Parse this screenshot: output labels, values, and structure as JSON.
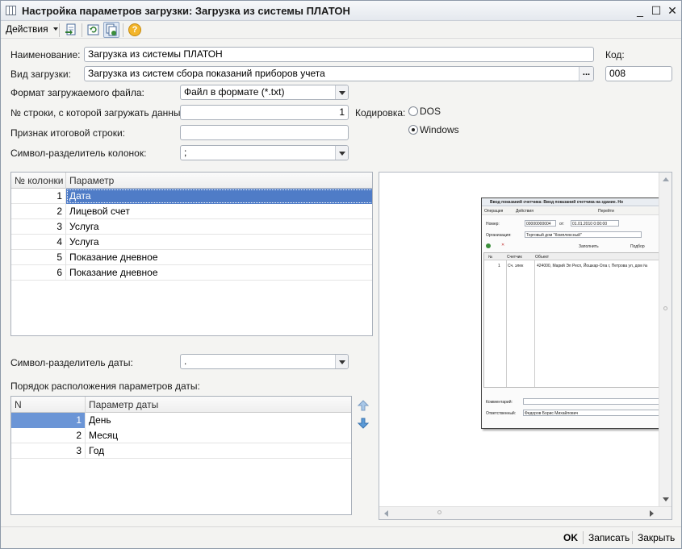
{
  "window": {
    "title": "Настройка параметров загрузки: Загрузка из системы ПЛАТОН",
    "minimize": "_",
    "maximize": "☐",
    "close": "✕"
  },
  "toolbar": {
    "actions_label": "Действия",
    "help_glyph": "?"
  },
  "form": {
    "name_label": "Наименование:",
    "name_value": "Загрузка из системы ПЛАТОН",
    "code_label": "Код:",
    "code_value": "008",
    "load_type_label": "Вид загрузки:",
    "load_type_value": "Загрузка из систем сбора показаний приборов учета",
    "load_type_button": "...",
    "file_format_label": "Формат загружаемого файла:",
    "file_format_value": "Файл в формате (*.txt)",
    "start_row_label": "№ строки, с которой загружать данные:",
    "start_row_value": "1",
    "encoding_label": "Кодировка:",
    "encoding_options": [
      "DOS",
      "Windows"
    ],
    "encoding_selected": "Windows",
    "total_row_label": "Признак итоговой строки:",
    "total_row_value": "",
    "column_sep_label": "Символ-разделитель колонок:",
    "column_sep_value": ";",
    "date_sep_label": "Символ-разделитель даты:",
    "date_sep_value": ".",
    "date_order_label": "Порядок расположения параметров даты:"
  },
  "columns_table": {
    "headers": [
      "№ колонки",
      "Параметр"
    ],
    "rows": [
      {
        "n": "1",
        "param": "Дата"
      },
      {
        "n": "2",
        "param": "Лицевой счет"
      },
      {
        "n": "3",
        "param": "Услуга"
      },
      {
        "n": "4",
        "param": "Услуга"
      },
      {
        "n": "5",
        "param": "Показание дневное"
      },
      {
        "n": "6",
        "param": "Показание дневное"
      }
    ]
  },
  "date_table": {
    "headers": [
      "N",
      "Параметр даты"
    ],
    "rows": [
      {
        "n": "1",
        "param": "День"
      },
      {
        "n": "2",
        "param": "Месяц"
      },
      {
        "n": "3",
        "param": "Год"
      }
    ]
  },
  "preview": {
    "title": "Ввод показаний счетчика: Ввод показаний счетчика на здание. Но",
    "toolbar": [
      "Операция",
      "Действия",
      "Перейти"
    ],
    "number_label": "Номер:",
    "number_value": "00000000004",
    "date_from_label": "от:",
    "date_value": "01.01.2010 0:00:00",
    "org_label": "Организация:",
    "org_value": "Торговый дом \"Комплексный\"",
    "tb2": [
      "Заполнить",
      "Подбор"
    ],
    "grid_headers": [
      "№",
      "Счетчик",
      "Объект"
    ],
    "grid_row": {
      "n": "1",
      "meter": "Сч. элек",
      "object": "424000, Марий Эл Респ, Йошкар-Ола г, Петрова ул, дом №"
    },
    "comment_label": "Комментарий:",
    "responsible_label": "Ответственный:",
    "responsible_value": "Федоров Борис Михайлович"
  },
  "footer": {
    "ok": "OK",
    "save": "Записать",
    "close": "Закрыть"
  }
}
